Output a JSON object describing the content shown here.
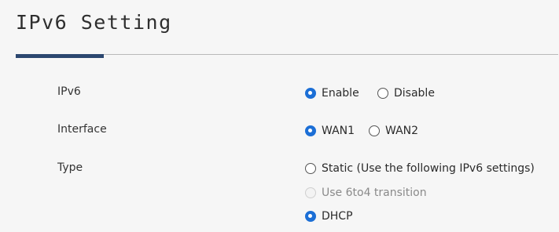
{
  "page": {
    "title": "IPv6 Setting"
  },
  "colors": {
    "accent": "#2c4770",
    "radio_checked": "#1c6fd6"
  },
  "rows": {
    "ipv6": {
      "label": "IPv6",
      "options": [
        {
          "label": "Enable",
          "checked": true,
          "disabled": false
        },
        {
          "label": "Disable",
          "checked": false,
          "disabled": false
        }
      ]
    },
    "interface": {
      "label": "Interface",
      "options": [
        {
          "label": "WAN1",
          "checked": true,
          "disabled": false
        },
        {
          "label": "WAN2",
          "checked": false,
          "disabled": false
        }
      ]
    },
    "type": {
      "label": "Type",
      "options": [
        {
          "label": "Static (Use the following IPv6 settings)",
          "checked": false,
          "disabled": false
        },
        {
          "label": "Use 6to4 transition",
          "checked": false,
          "disabled": true
        },
        {
          "label": "DHCP",
          "checked": true,
          "disabled": false
        }
      ]
    }
  }
}
